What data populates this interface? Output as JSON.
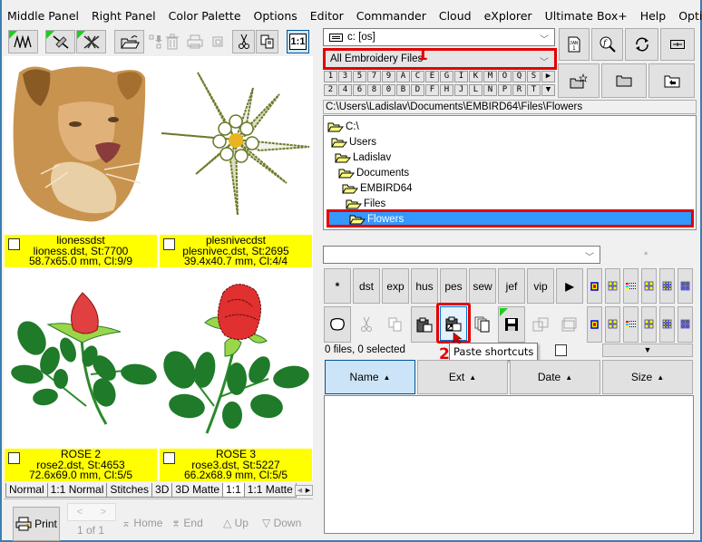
{
  "menu": [
    "Middle Panel",
    "Right Panel",
    "Color Palette",
    "Options",
    "Editor",
    "Commander",
    "Cloud",
    "eXplorer",
    "Ultimate Box+",
    "Help",
    "Optional Plug-ins"
  ],
  "toolbar": {
    "zoom_label": "1:1",
    "icons": [
      "stitch-zigzag-icon",
      "edit-design-icon",
      "delete-stitches-icon",
      "open-folder-icon",
      "move-icon",
      "delete-icon",
      "print-icon",
      "window-icon",
      "cut-icon",
      "copy-icon",
      "actual-size-icon"
    ]
  },
  "thumbnails": [
    {
      "title": "lionessdst",
      "line2": "lioness.dst, St:7700",
      "line3": "58.7x65.0 mm, Cl:9/9",
      "image": "lioness-embroidery"
    },
    {
      "title": "plesnivecdst",
      "line2": "plesnivec.dst, St:2695",
      "line3": "39.4x40.7 mm, Cl:4/4",
      "image": "edelweiss-embroidery"
    },
    {
      "title": "ROSE 2",
      "line2": "rose2.dst, St:4653",
      "line3": "72.6x69.0 mm, Cl:5/5",
      "image": "rosebud-embroidery"
    },
    {
      "title": "ROSE 3",
      "line2": "rose3.dst, St:5227",
      "line3": "66.2x68.9 mm, Cl:5/5",
      "image": "rose-embroidery"
    }
  ],
  "view_tabs": [
    "Normal",
    "1:1 Normal",
    "Stitches",
    "3D",
    "3D Matte",
    "1:1",
    "1:1 Matte"
  ],
  "active_view_tab": "1:1",
  "bottom": {
    "print_label": "Print",
    "page_label": "1 of 1",
    "home_label": "Home",
    "end_label": "End",
    "up_label": "Up",
    "down_label": "Down"
  },
  "drive": {
    "value": "c: [os]"
  },
  "filter": {
    "value": "All Embroidery Files",
    "annotation": "1"
  },
  "letters_row1": [
    "1",
    "3",
    "5",
    "7",
    "9",
    "A",
    "C",
    "E",
    "G",
    "I",
    "K",
    "M",
    "O",
    "Q",
    "S",
    "▶"
  ],
  "letters_row2": [
    "2",
    "4",
    "6",
    "8",
    "0",
    "B",
    "D",
    "F",
    "H",
    "J",
    "L",
    "N",
    "P",
    "R",
    "T",
    "▼"
  ],
  "path": "C:\\Users\\Ladislav\\Documents\\EMBIRD64\\Files\\Flowers",
  "tree": [
    {
      "label": "C:\\",
      "level": 0
    },
    {
      "label": "Users",
      "level": 1
    },
    {
      "label": "Ladislav",
      "level": 2
    },
    {
      "label": "Documents",
      "level": 3
    },
    {
      "label": "EMBIRD64",
      "level": 4
    },
    {
      "label": "Files",
      "level": 5
    },
    {
      "label": "Flowers",
      "level": 6,
      "selected": true
    }
  ],
  "extension_combo": {
    "value": ""
  },
  "asterisk_label": "*",
  "format_buttons": [
    "*",
    "dst",
    "exp",
    "hus",
    "pes",
    "sew",
    "jef",
    "vip",
    "▶"
  ],
  "action_buttons": [
    "select-lasso-icon",
    "cut-icon",
    "copy-icon",
    "paste-icon",
    "paste-shortcuts-icon",
    "copy-files-icon",
    "save-icon",
    "export-icon",
    "window-icon"
  ],
  "tooltip": {
    "text": "Paste shortcuts",
    "annotation": "2"
  },
  "status": "0 files, 0 selected",
  "columns": [
    {
      "label": "Name",
      "sort": "▲",
      "active": true
    },
    {
      "label": "Ext",
      "sort": "▲"
    },
    {
      "label": "Date",
      "sort": "▲"
    },
    {
      "label": "Size",
      "sort": "▲"
    }
  ],
  "dropdown_arrow": "▼",
  "colors": {
    "accent_red": "#e30000",
    "selection_blue": "#3399ff",
    "caption_yellow": "#ffff00",
    "window_border": "#3c7fb1"
  }
}
